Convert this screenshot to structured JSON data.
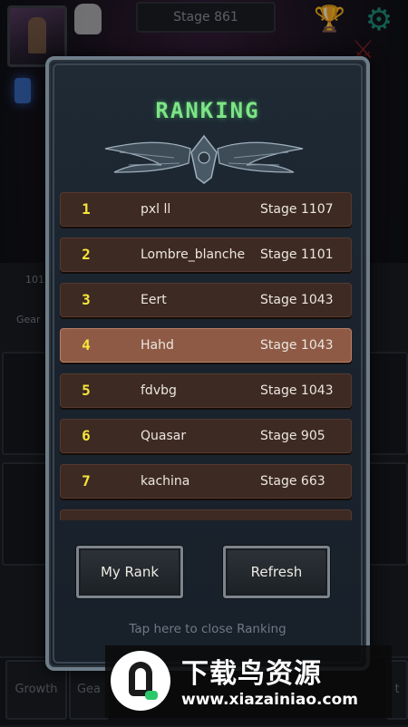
{
  "background": {
    "stage_label": "Stage 861",
    "side_counter": "101",
    "side_tab_label": "Gear",
    "bottom_tabs": [
      "Growth",
      "Gea",
      "t"
    ]
  },
  "panel": {
    "title": "RANKING",
    "rows": [
      {
        "rank": "1",
        "name": "pxl ll",
        "stage": "Stage 1107",
        "highlight": false
      },
      {
        "rank": "2",
        "name": "Lombre_blanche",
        "stage": "Stage 1101",
        "highlight": false
      },
      {
        "rank": "3",
        "name": "Eert",
        "stage": "Stage 1043",
        "highlight": false
      },
      {
        "rank": "4",
        "name": "Hahd",
        "stage": "Stage 1043",
        "highlight": true
      },
      {
        "rank": "5",
        "name": "fdvbg",
        "stage": "Stage 1043",
        "highlight": false
      },
      {
        "rank": "6",
        "name": "Quasar",
        "stage": "Stage 905",
        "highlight": false
      },
      {
        "rank": "7",
        "name": "kachina",
        "stage": "Stage 663",
        "highlight": false
      },
      {
        "rank": "8",
        "name": "",
        "stage": "",
        "highlight": false
      }
    ],
    "my_rank_label": "My Rank",
    "refresh_label": "Refresh",
    "close_hint": "Tap here to close Ranking"
  },
  "watermark": {
    "brand": "下载鸟资源",
    "url": "www.xiazainiao.com"
  },
  "colors": {
    "title_green": "#7ee486",
    "rank_yellow": "#f6e53c",
    "row_brown": "#3d2a23",
    "row_highlight": "#8e5a46"
  }
}
